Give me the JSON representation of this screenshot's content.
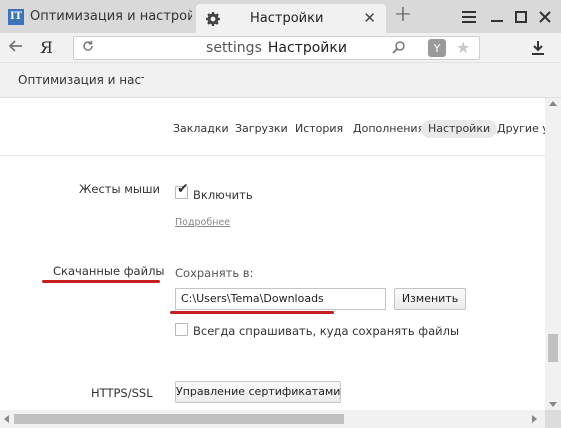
{
  "tabs": [
    {
      "title": "Оптимизация и настройка",
      "favicon": "IT"
    },
    {
      "title": "Настройки"
    }
  ],
  "window_controls": {
    "menu": "≡",
    "minimize": "—",
    "maximize": "□",
    "close": "✕",
    "new_tab": "+"
  },
  "address_bar": {
    "logo": "Я",
    "host": "settings",
    "page": "Настройки",
    "yandex_icon": "Y"
  },
  "bookmarks": [
    {
      "label": "Оптимизация и настройка"
    }
  ],
  "nav_tabs": [
    {
      "label": "Закладки"
    },
    {
      "label": "Загрузки"
    },
    {
      "label": "История"
    },
    {
      "label": "Дополнения"
    },
    {
      "label": "Настройки",
      "active": true
    },
    {
      "label": "Другие устройства"
    }
  ],
  "settings": {
    "mouse_gestures": {
      "label": "Жесты мыши",
      "checkbox_label": "Включить",
      "checked": true,
      "more_link": "Подробнее"
    },
    "downloads": {
      "label": "Скачанные файлы",
      "save_to_label": "Сохранять в:",
      "path": "C:\\Users\\Tema\\Downloads",
      "change_button": "Изменить",
      "always_ask_label": "Всегда спрашивать, куда сохранять файлы",
      "always_ask_checked": false
    },
    "https": {
      "label": "HTTPS/SSL",
      "certs_button": "Управление сертификатами"
    }
  },
  "colors": {
    "annotation_red": "#c61f1f",
    "tab_active_bg": "#f1f1f1",
    "tabbar_bg": "#d9d9d9"
  }
}
